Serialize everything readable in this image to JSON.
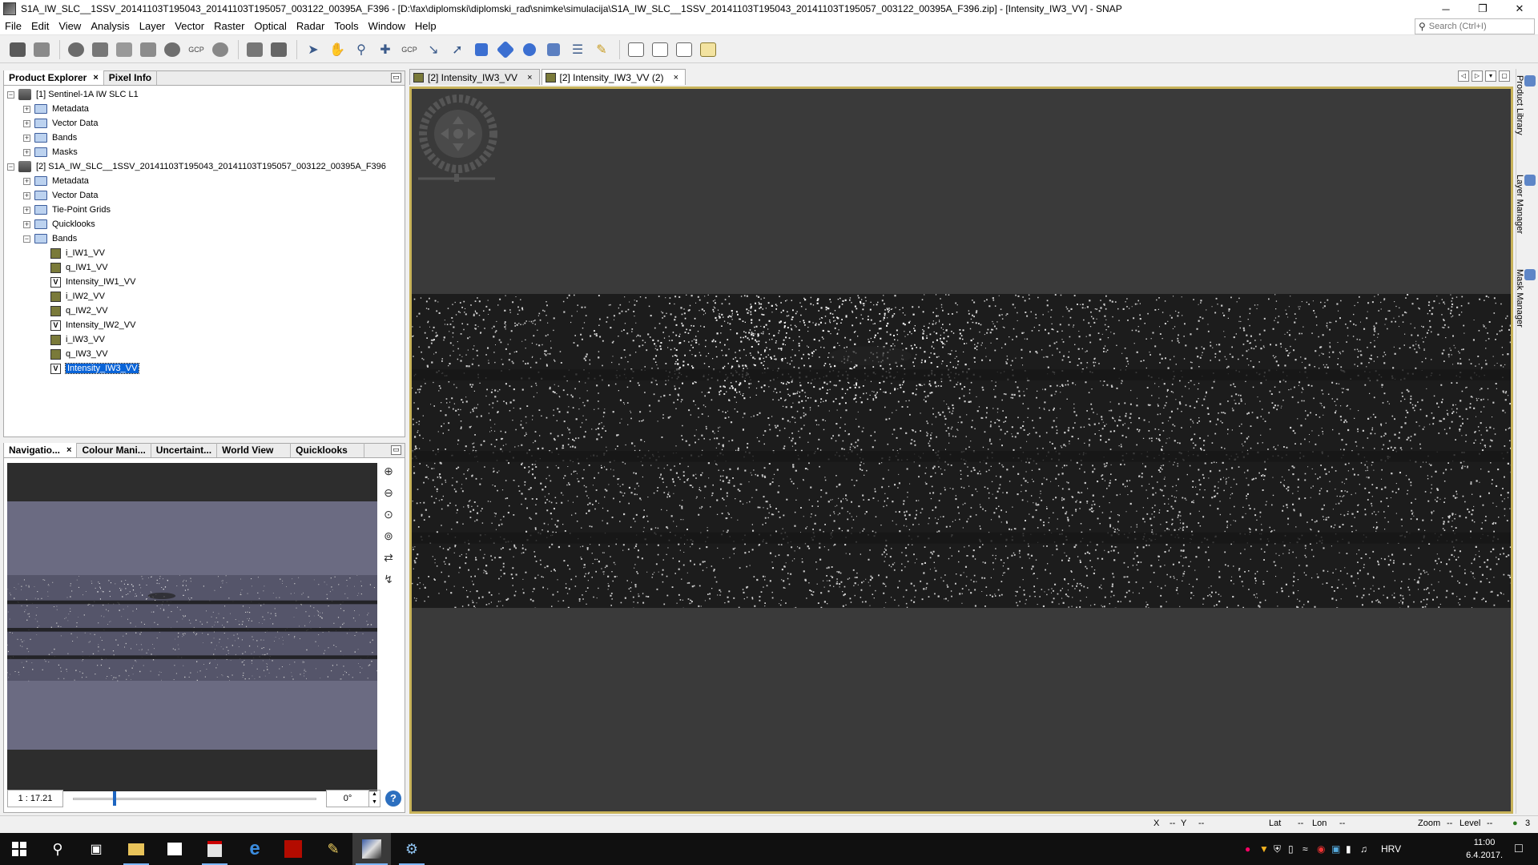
{
  "window": {
    "title": "S1A_IW_SLC__1SSV_20141103T195043_20141103T195057_003122_00395A_F396 - [D:\\fax\\diplomski\\diplomski_rad\\snimke\\simulacija\\S1A_IW_SLC__1SSV_20141103T195043_20141103T195057_003122_00395A_F396.zip] - [Intensity_IW3_VV] - SNAP",
    "min_glyph": "─",
    "max_glyph": "❐",
    "close_glyph": "✕"
  },
  "menu": [
    "File",
    "Edit",
    "View",
    "Analysis",
    "Layer",
    "Vector",
    "Raster",
    "Optical",
    "Radar",
    "Tools",
    "Window",
    "Help"
  ],
  "search": {
    "placeholder": "Search (Ctrl+I)"
  },
  "toolbar": {
    "gcp_label": "GCP",
    "gcp_label_2": "GCP"
  },
  "product_explorer": {
    "tabs": [
      {
        "label": "Product Explorer",
        "active": true
      },
      {
        "label": "Pixel Info",
        "active": false
      }
    ],
    "close_glyph": "×",
    "minimize_glyph": "▭",
    "tree": [
      {
        "level": 0,
        "label": "[1] Sentinel-1A IW SLC L1",
        "icon": "product",
        "expander": "−"
      },
      {
        "level": 1,
        "label": "Metadata",
        "icon": "folder",
        "expander": "+"
      },
      {
        "level": 1,
        "label": "Vector Data",
        "icon": "folder",
        "expander": "+"
      },
      {
        "level": 1,
        "label": "Bands",
        "icon": "folder",
        "expander": "+"
      },
      {
        "level": 1,
        "label": "Masks",
        "icon": "folder",
        "expander": "+"
      },
      {
        "level": 0,
        "label": "[2] S1A_IW_SLC__1SSV_20141103T195043_20141103T195057_003122_00395A_F396",
        "icon": "product",
        "expander": "−"
      },
      {
        "level": 1,
        "label": "Metadata",
        "icon": "folder",
        "expander": "+"
      },
      {
        "level": 1,
        "label": "Vector Data",
        "icon": "folder",
        "expander": "+"
      },
      {
        "level": 1,
        "label": "Tie-Point Grids",
        "icon": "folder",
        "expander": "+"
      },
      {
        "level": 1,
        "label": "Quicklooks",
        "icon": "folder",
        "expander": "+"
      },
      {
        "level": 1,
        "label": "Bands",
        "icon": "folder-open",
        "expander": "−"
      },
      {
        "level": 2,
        "label": "i_IW1_VV",
        "icon": "band"
      },
      {
        "level": 2,
        "label": "q_IW1_VV",
        "icon": "band"
      },
      {
        "level": 2,
        "label": "Intensity_IW1_VV",
        "icon": "virtual-band",
        "icon_text": "V"
      },
      {
        "level": 2,
        "label": "i_IW2_VV",
        "icon": "band"
      },
      {
        "level": 2,
        "label": "q_IW2_VV",
        "icon": "band"
      },
      {
        "level": 2,
        "label": "Intensity_IW2_VV",
        "icon": "virtual-band",
        "icon_text": "V"
      },
      {
        "level": 2,
        "label": "i_IW3_VV",
        "icon": "band"
      },
      {
        "level": 2,
        "label": "q_IW3_VV",
        "icon": "band"
      },
      {
        "level": 2,
        "label": "Intensity_IW3_VV",
        "icon": "virtual-band",
        "icon_text": "V",
        "selected": true
      }
    ]
  },
  "navigation_panel": {
    "tabs": [
      {
        "label": "Navigatio...",
        "active": true,
        "closable": true
      },
      {
        "label": "Colour Mani...",
        "active": false
      },
      {
        "label": "Uncertaint...",
        "active": false
      },
      {
        "label": "World View",
        "active": false
      },
      {
        "label": "Quicklooks",
        "active": false
      }
    ],
    "close_glyph": "×",
    "minimize_glyph": "▭",
    "scale": "1 : 17.21",
    "zoom_slider_fraction": 0.165,
    "rotation": "0°",
    "spin_up": "▲",
    "spin_down": "▼",
    "help": "?",
    "side_buttons": [
      {
        "name": "zoom-in-button",
        "glyph": "⊕"
      },
      {
        "name": "zoom-out-button",
        "glyph": "⊖"
      },
      {
        "name": "zoom-pixel-button",
        "glyph": "⊙"
      },
      {
        "name": "zoom-all-button",
        "glyph": "⊚"
      },
      {
        "name": "sync-views-button",
        "glyph": "⇄"
      },
      {
        "name": "sync-cursor-button",
        "glyph": "↯"
      }
    ]
  },
  "image_view": {
    "tabs": [
      {
        "label": "[2] Intensity_IW3_VV",
        "active": false
      },
      {
        "label": "[2] Intensity_IW3_VV (2)",
        "active": true
      }
    ],
    "close_glyph": "×",
    "controls": [
      "◁",
      "▷",
      "▾",
      "▢"
    ]
  },
  "right_sidebar": [
    "Product Library",
    "Layer Manager",
    "Mask Manager"
  ],
  "status_bar": {
    "x_label": "X",
    "x_value": "--",
    "y_label": "Y",
    "y_value": "--",
    "lat_label": "Lat",
    "lat_value": "--",
    "lon_label": "Lon",
    "lon_value": "--",
    "zoom_label": "Zoom",
    "zoom_value": "--",
    "level_label": "Level",
    "level_value": "--",
    "notifications": "3"
  },
  "taskbar": {
    "language": "HRV",
    "time": "11:00",
    "date": "6.4.2017."
  },
  "colors": {
    "selection": "#0a64d8",
    "frame_highlight": "#c8b35a",
    "canvas_background": "#3a3a3a",
    "taskbar": "#101010"
  }
}
